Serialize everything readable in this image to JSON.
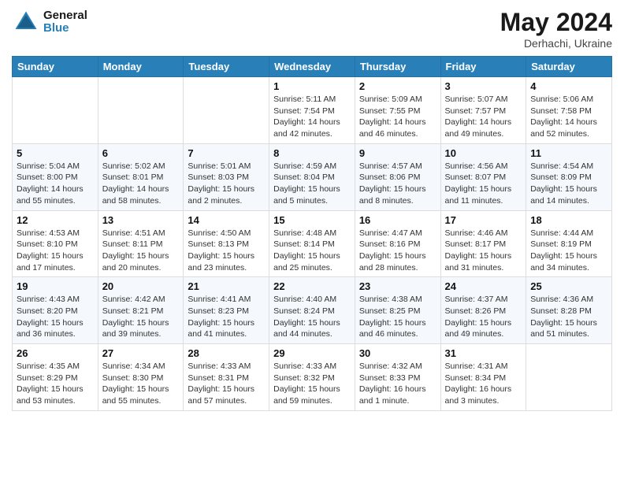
{
  "header": {
    "logo_line1": "General",
    "logo_line2": "Blue",
    "month_title": "May 2024",
    "location": "Derhachi, Ukraine"
  },
  "days_of_week": [
    "Sunday",
    "Monday",
    "Tuesday",
    "Wednesday",
    "Thursday",
    "Friday",
    "Saturday"
  ],
  "weeks": [
    [
      {
        "day": "",
        "sunrise": "",
        "sunset": "",
        "daylight": ""
      },
      {
        "day": "",
        "sunrise": "",
        "sunset": "",
        "daylight": ""
      },
      {
        "day": "",
        "sunrise": "",
        "sunset": "",
        "daylight": ""
      },
      {
        "day": "1",
        "sunrise": "Sunrise: 5:11 AM",
        "sunset": "Sunset: 7:54 PM",
        "daylight": "Daylight: 14 hours and 42 minutes."
      },
      {
        "day": "2",
        "sunrise": "Sunrise: 5:09 AM",
        "sunset": "Sunset: 7:55 PM",
        "daylight": "Daylight: 14 hours and 46 minutes."
      },
      {
        "day": "3",
        "sunrise": "Sunrise: 5:07 AM",
        "sunset": "Sunset: 7:57 PM",
        "daylight": "Daylight: 14 hours and 49 minutes."
      },
      {
        "day": "4",
        "sunrise": "Sunrise: 5:06 AM",
        "sunset": "Sunset: 7:58 PM",
        "daylight": "Daylight: 14 hours and 52 minutes."
      }
    ],
    [
      {
        "day": "5",
        "sunrise": "Sunrise: 5:04 AM",
        "sunset": "Sunset: 8:00 PM",
        "daylight": "Daylight: 14 hours and 55 minutes."
      },
      {
        "day": "6",
        "sunrise": "Sunrise: 5:02 AM",
        "sunset": "Sunset: 8:01 PM",
        "daylight": "Daylight: 14 hours and 58 minutes."
      },
      {
        "day": "7",
        "sunrise": "Sunrise: 5:01 AM",
        "sunset": "Sunset: 8:03 PM",
        "daylight": "Daylight: 15 hours and 2 minutes."
      },
      {
        "day": "8",
        "sunrise": "Sunrise: 4:59 AM",
        "sunset": "Sunset: 8:04 PM",
        "daylight": "Daylight: 15 hours and 5 minutes."
      },
      {
        "day": "9",
        "sunrise": "Sunrise: 4:57 AM",
        "sunset": "Sunset: 8:06 PM",
        "daylight": "Daylight: 15 hours and 8 minutes."
      },
      {
        "day": "10",
        "sunrise": "Sunrise: 4:56 AM",
        "sunset": "Sunset: 8:07 PM",
        "daylight": "Daylight: 15 hours and 11 minutes."
      },
      {
        "day": "11",
        "sunrise": "Sunrise: 4:54 AM",
        "sunset": "Sunset: 8:09 PM",
        "daylight": "Daylight: 15 hours and 14 minutes."
      }
    ],
    [
      {
        "day": "12",
        "sunrise": "Sunrise: 4:53 AM",
        "sunset": "Sunset: 8:10 PM",
        "daylight": "Daylight: 15 hours and 17 minutes."
      },
      {
        "day": "13",
        "sunrise": "Sunrise: 4:51 AM",
        "sunset": "Sunset: 8:11 PM",
        "daylight": "Daylight: 15 hours and 20 minutes."
      },
      {
        "day": "14",
        "sunrise": "Sunrise: 4:50 AM",
        "sunset": "Sunset: 8:13 PM",
        "daylight": "Daylight: 15 hours and 23 minutes."
      },
      {
        "day": "15",
        "sunrise": "Sunrise: 4:48 AM",
        "sunset": "Sunset: 8:14 PM",
        "daylight": "Daylight: 15 hours and 25 minutes."
      },
      {
        "day": "16",
        "sunrise": "Sunrise: 4:47 AM",
        "sunset": "Sunset: 8:16 PM",
        "daylight": "Daylight: 15 hours and 28 minutes."
      },
      {
        "day": "17",
        "sunrise": "Sunrise: 4:46 AM",
        "sunset": "Sunset: 8:17 PM",
        "daylight": "Daylight: 15 hours and 31 minutes."
      },
      {
        "day": "18",
        "sunrise": "Sunrise: 4:44 AM",
        "sunset": "Sunset: 8:19 PM",
        "daylight": "Daylight: 15 hours and 34 minutes."
      }
    ],
    [
      {
        "day": "19",
        "sunrise": "Sunrise: 4:43 AM",
        "sunset": "Sunset: 8:20 PM",
        "daylight": "Daylight: 15 hours and 36 minutes."
      },
      {
        "day": "20",
        "sunrise": "Sunrise: 4:42 AM",
        "sunset": "Sunset: 8:21 PM",
        "daylight": "Daylight: 15 hours and 39 minutes."
      },
      {
        "day": "21",
        "sunrise": "Sunrise: 4:41 AM",
        "sunset": "Sunset: 8:23 PM",
        "daylight": "Daylight: 15 hours and 41 minutes."
      },
      {
        "day": "22",
        "sunrise": "Sunrise: 4:40 AM",
        "sunset": "Sunset: 8:24 PM",
        "daylight": "Daylight: 15 hours and 44 minutes."
      },
      {
        "day": "23",
        "sunrise": "Sunrise: 4:38 AM",
        "sunset": "Sunset: 8:25 PM",
        "daylight": "Daylight: 15 hours and 46 minutes."
      },
      {
        "day": "24",
        "sunrise": "Sunrise: 4:37 AM",
        "sunset": "Sunset: 8:26 PM",
        "daylight": "Daylight: 15 hours and 49 minutes."
      },
      {
        "day": "25",
        "sunrise": "Sunrise: 4:36 AM",
        "sunset": "Sunset: 8:28 PM",
        "daylight": "Daylight: 15 hours and 51 minutes."
      }
    ],
    [
      {
        "day": "26",
        "sunrise": "Sunrise: 4:35 AM",
        "sunset": "Sunset: 8:29 PM",
        "daylight": "Daylight: 15 hours and 53 minutes."
      },
      {
        "day": "27",
        "sunrise": "Sunrise: 4:34 AM",
        "sunset": "Sunset: 8:30 PM",
        "daylight": "Daylight: 15 hours and 55 minutes."
      },
      {
        "day": "28",
        "sunrise": "Sunrise: 4:33 AM",
        "sunset": "Sunset: 8:31 PM",
        "daylight": "Daylight: 15 hours and 57 minutes."
      },
      {
        "day": "29",
        "sunrise": "Sunrise: 4:33 AM",
        "sunset": "Sunset: 8:32 PM",
        "daylight": "Daylight: 15 hours and 59 minutes."
      },
      {
        "day": "30",
        "sunrise": "Sunrise: 4:32 AM",
        "sunset": "Sunset: 8:33 PM",
        "daylight": "Daylight: 16 hours and 1 minute."
      },
      {
        "day": "31",
        "sunrise": "Sunrise: 4:31 AM",
        "sunset": "Sunset: 8:34 PM",
        "daylight": "Daylight: 16 hours and 3 minutes."
      },
      {
        "day": "",
        "sunrise": "",
        "sunset": "",
        "daylight": ""
      }
    ]
  ]
}
